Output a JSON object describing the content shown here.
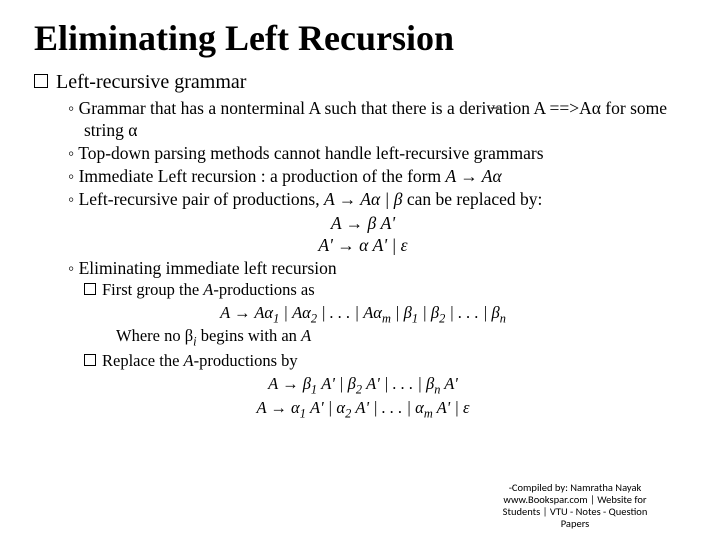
{
  "title": "Eliminating Left Recursion",
  "l1": "Left-recursive grammar",
  "b1": "Grammar that has a nonterminal A such that there is a deriv̶ation   A ==>Aα for some string α",
  "b2": "Top-down parsing methods cannot handle left-recursive grammars",
  "b3_a": "Immediate Left recursion : a production of the form ",
  "b3_b": "A → Aα",
  "b4_a": "Left-recursive pair of productions,  ",
  "b4_b": "A → Aα | β",
  "b4_c": "  can be replaced by:",
  "c1": "A → β A'",
  "c2": "A' → α A' |  ε",
  "b5": "Eliminating immediate left recursion",
  "s1_a": "First group the ",
  "s1_b": "A",
  "s1_c": "-productions as",
  "sc1_html": "<i>A → Aα<sub>1</sub> | Aα<sub>2</sub> | . . . | Aα<sub>m</sub> | β<sub>1</sub> | β<sub>2</sub> | . . .  | β<sub>n</sub></i>",
  "s1w_a": "Where no β",
  "s1w_b": " begins with an ",
  "s1w_c": "A",
  "s2_a": "Replace the ",
  "s2_b": "A",
  "s2_c": "-productions by",
  "sc2_html": "<i>A → β<sub>1</sub> A'  | β<sub>2</sub> A' | . . . | β<sub>n</sub> A'</i>",
  "sc3_html": "<i>A → α<sub>1</sub> A'  | α<sub>2</sub> A' | . . .  | α<sub>m</sub> A' | ε</i>",
  "footer": {
    "l1": "-Compiled by: Namratha Nayak",
    "l2": "www.Bookspar.com | Website for",
    "l3": "Students | VTU - Notes - Question",
    "l4": "Papers"
  }
}
